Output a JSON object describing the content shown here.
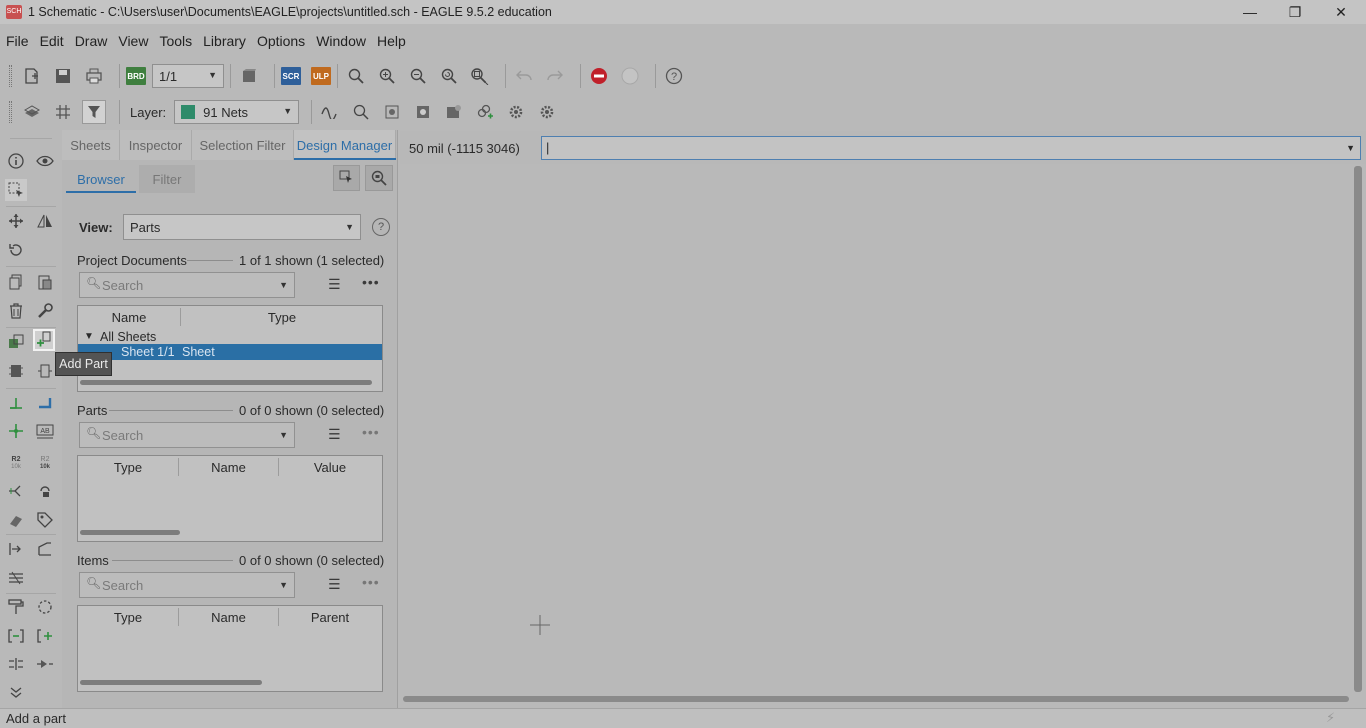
{
  "window": {
    "title": "1 Schematic - C:\\Users\\user\\Documents\\EAGLE\\projects\\untitled.sch - EAGLE 9.5.2 education",
    "app_icon": "SCH",
    "minimize": "—",
    "restore": "❐",
    "close": "✕"
  },
  "menu": [
    "File",
    "Edit",
    "Draw",
    "View",
    "Tools",
    "Library",
    "Options",
    "Window",
    "Help"
  ],
  "toolbar1": {
    "brd_badge": "BRD",
    "sheet_select": "1/1",
    "scr_badge": "SCR",
    "ulp_badge": "ULP",
    "help_icon": "?"
  },
  "toolbar2": {
    "layer_label": "Layer:",
    "layer_value": "91 Nets",
    "layer_color": "#2e8b6a"
  },
  "panel": {
    "tabs": [
      "Sheets",
      "Inspector",
      "Selection Filter",
      "Design Manager"
    ],
    "active_tab": "Design Manager",
    "subtabs": [
      "Browser",
      "Filter"
    ],
    "view_label": "View:",
    "view_value": "Parts",
    "view_help": "?",
    "project_documents": {
      "title": "Project Documents",
      "count": "1 of 1 shown (1 selected)",
      "search_placeholder": "Search",
      "columns": [
        "Name",
        "Type"
      ],
      "group": "All Sheets",
      "row": {
        "name": "Sheet 1/1",
        "type": "Sheet"
      }
    },
    "parts": {
      "title": "Parts",
      "count": "0 of 0 shown (0 selected)",
      "search_placeholder": "Search",
      "columns": [
        "Type",
        "Name",
        "Value"
      ]
    },
    "items": {
      "title": "Items",
      "count": "0 of 0 shown (0 selected)",
      "search_placeholder": "Search",
      "columns": [
        "Type",
        "Name",
        "Parent"
      ]
    }
  },
  "coord": "50 mil (-1115 3046)",
  "command_value": "|",
  "tooltip": "Add Part",
  "status": "Add a part",
  "colors": {
    "accent": "#2d6ea8",
    "selection": "#2a6fa5",
    "stop_red": "#c0202a"
  }
}
